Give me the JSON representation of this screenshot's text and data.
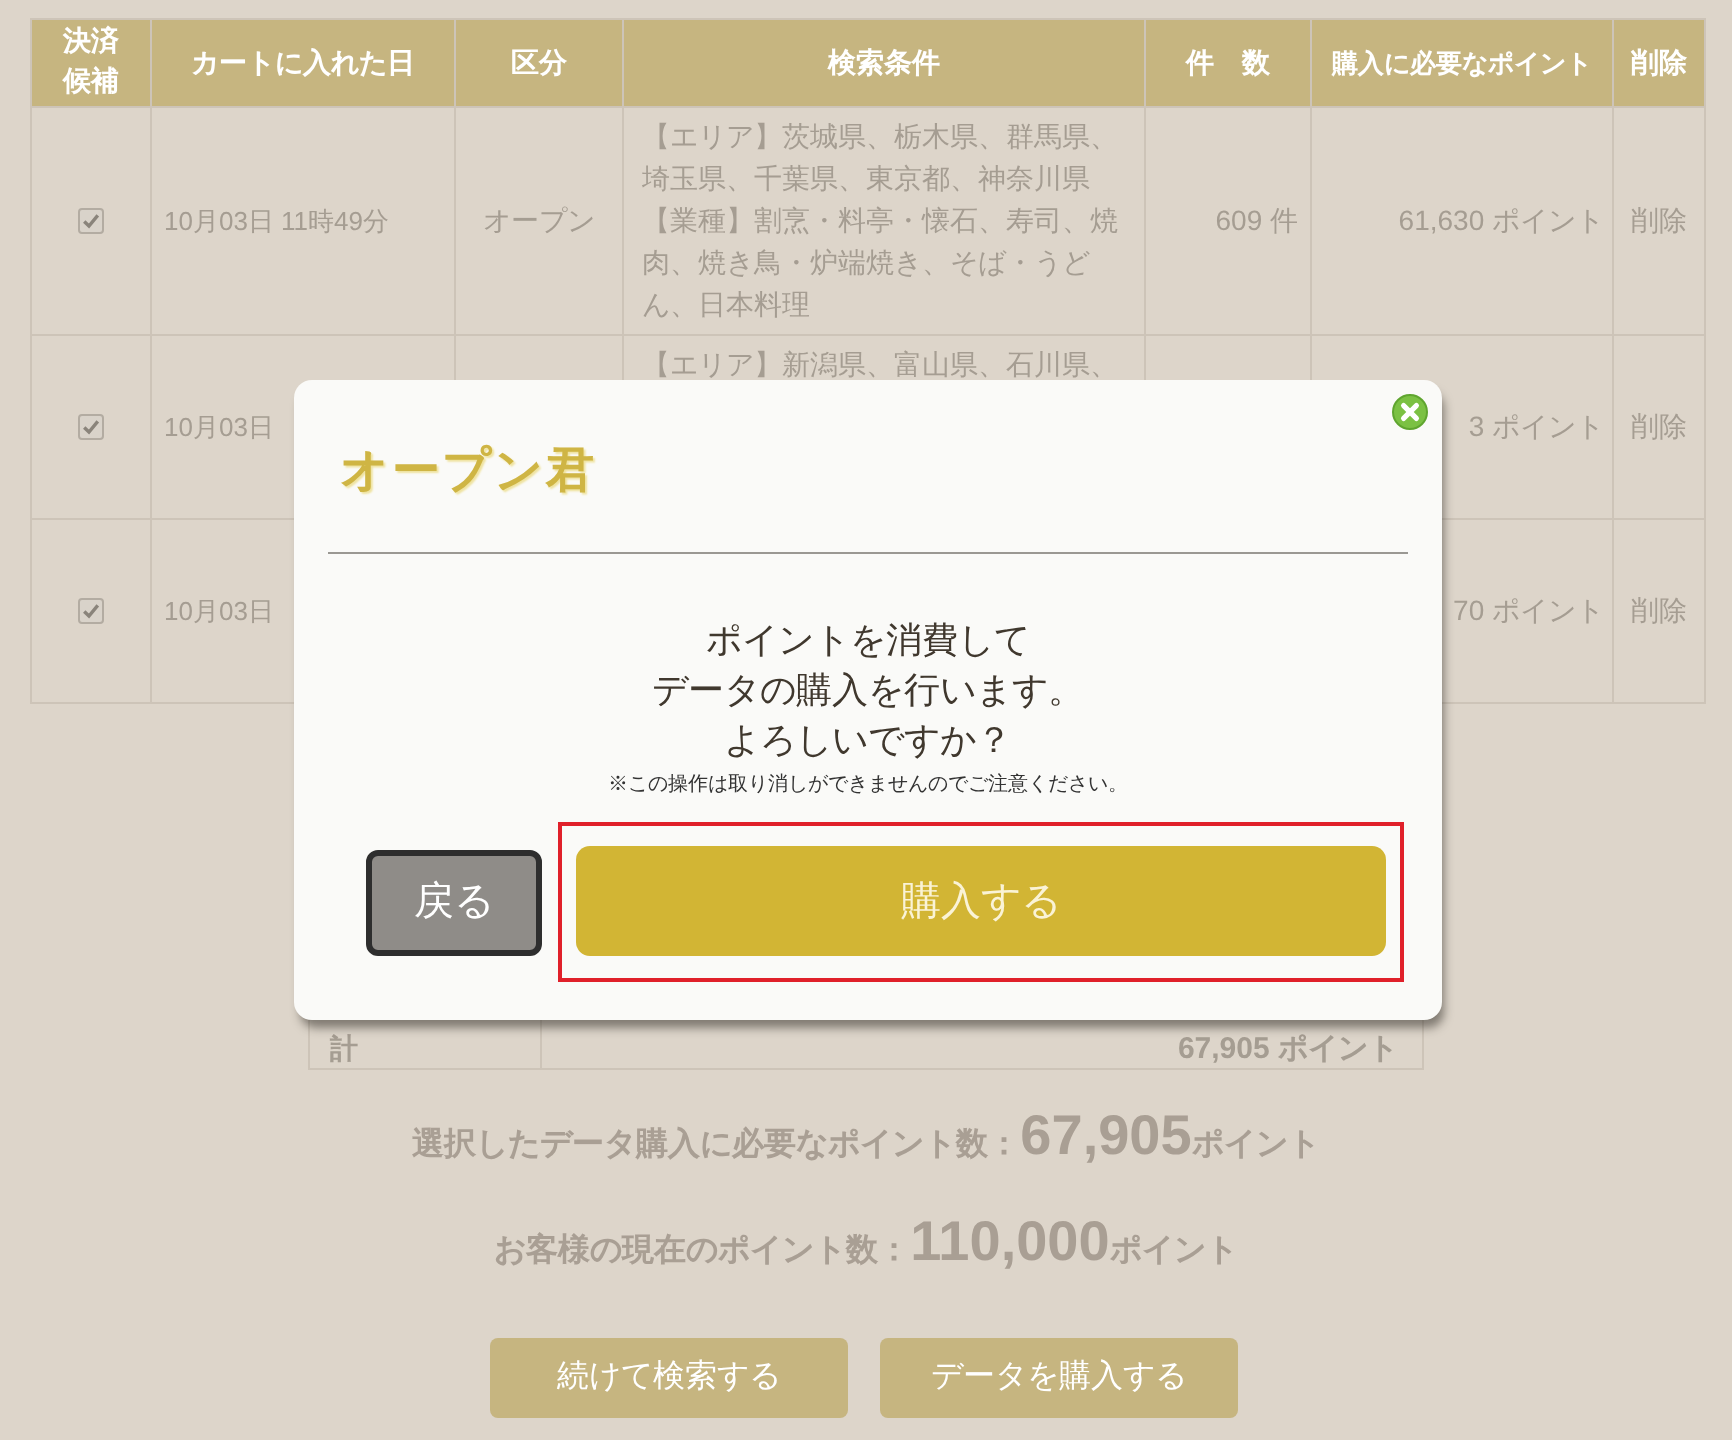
{
  "cart_table": {
    "columns": [
      "決済候補",
      "カートに入れた日",
      "区分",
      "検索条件",
      "件　数",
      "購入に必要なポイント",
      "削除"
    ],
    "rows": [
      {
        "checked": true,
        "date": "10月03日 11時49分",
        "category": "オープン",
        "conditions": [
          "【エリア】茨城県、栃木県、群馬県、埼玉県、千葉県、東京都、神奈川県",
          "【業種】割烹・料亭・懐石、寿司、焼肉、焼き鳥・炉端焼き、そば・うどん、日本料理"
        ],
        "count": "609 件",
        "points": "61,630 ポイント",
        "delete": "削除"
      },
      {
        "checked": true,
        "date": "10月03日",
        "conditions": [
          "【エリア】新潟県、富山県、石川県、"
        ],
        "points": "3 ポイント",
        "delete": "削除"
      },
      {
        "checked": true,
        "date": "10月03日",
        "points": "70 ポイント",
        "delete": "削除"
      }
    ]
  },
  "breakdown_total": {
    "label": "計",
    "value": "67,905 ポイント"
  },
  "summary": [
    {
      "label": "選択したデータ購入に必要なポイント数：",
      "value": "67,905",
      "unit": "ポイント"
    },
    {
      "label": "お客様の現在のポイント数：",
      "value": "110,000",
      "unit": "ポイント"
    }
  ],
  "actions": [
    "続けて検索する",
    "データを購入する"
  ],
  "dialog": {
    "title": "オープン君",
    "message_lines": [
      "ポイントを消費して",
      "データの購入を行います。",
      "よろしいですか？"
    ],
    "note": "※この操作は取り消しができませんのでご注意ください。",
    "buttons": [
      {
        "label": "戻る",
        "kind": "secondary",
        "highlighted": false
      },
      {
        "label": "購入する",
        "kind": "primary",
        "highlighted": true
      }
    ]
  }
}
